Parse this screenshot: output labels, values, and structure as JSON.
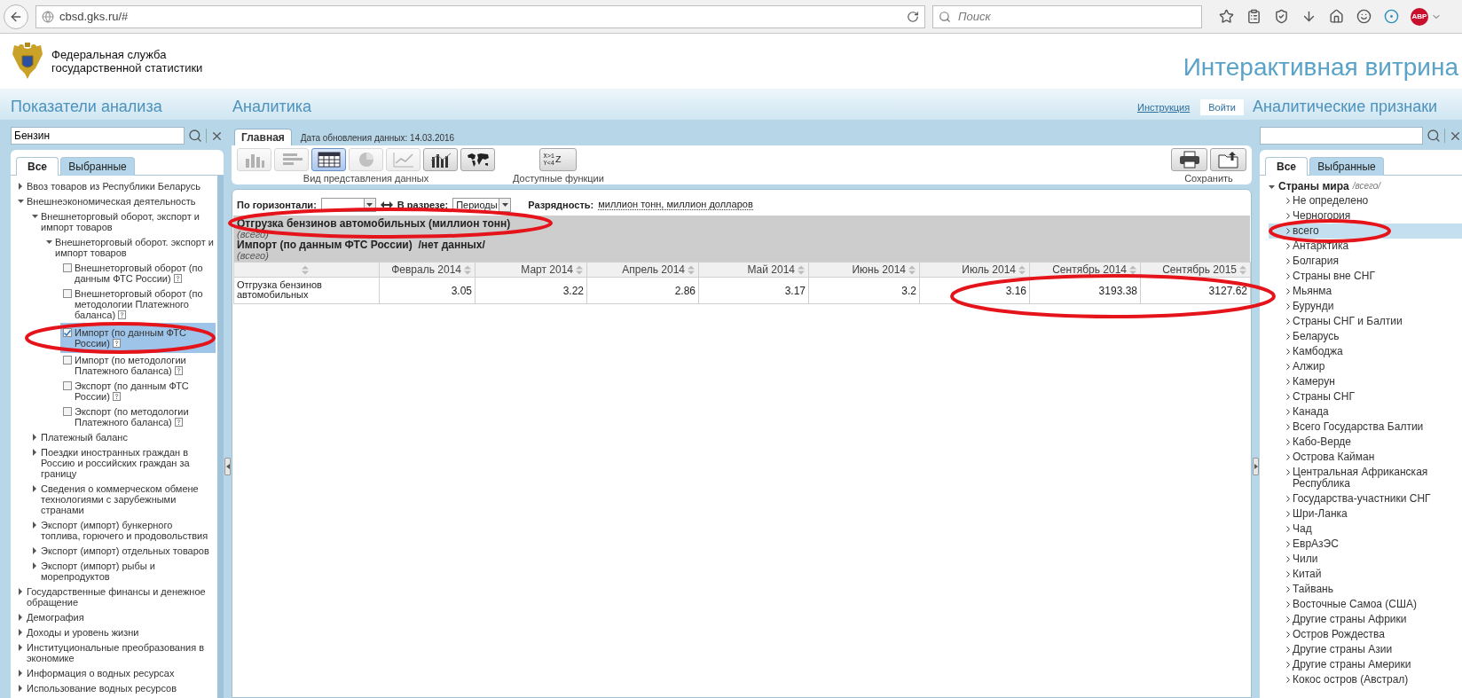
{
  "browser": {
    "url": "cbsd.gks.ru/#",
    "search_placeholder": "Поиск",
    "adblock_label": "ABP"
  },
  "header": {
    "org_lines": [
      "Федеральная служба",
      "государственной статистики"
    ],
    "title": "Интерактивная витрина"
  },
  "section_bar": {
    "left_title": "Показатели анализа",
    "center_title": "Аналитика",
    "help_link": "Инструкция",
    "login_button": "Войти",
    "right_title": "Аналитические признаки"
  },
  "left_panel": {
    "search": {
      "value": "Бензин"
    },
    "tabs": [
      {
        "label": "Все",
        "selected": true
      },
      {
        "label": "Выбранные",
        "selected": false
      }
    ],
    "tree": [
      {
        "kind": "group",
        "label": "Ввоз товаров из Республики Беларусь",
        "expanded": false
      },
      {
        "kind": "group",
        "label": "Внешнеэкономическая деятельность",
        "expanded": true,
        "children": [
          {
            "kind": "group",
            "label": "Внешнеторговый оборот, экспорт и импорт товаров",
            "expanded": true,
            "children": [
              {
                "kind": "group",
                "label": "Внешнеторговый оборот. экспорт и импорт товаров",
                "expanded": true,
                "children": [
                  {
                    "kind": "check",
                    "label": "Внешнеторговый оборот (по данным ФТС России)",
                    "checked": false,
                    "selected": false,
                    "circled": false
                  },
                  {
                    "kind": "check",
                    "label": "Внешнеторговый оборот (по методологии Платежного баланса)",
                    "checked": false,
                    "selected": false,
                    "circled": false
                  },
                  {
                    "kind": "check",
                    "label": "Импорт (по данным ФТС России)",
                    "checked": true,
                    "selected": true,
                    "circled": true
                  },
                  {
                    "kind": "check",
                    "label": "Импорт (по методологии Платежного баланса)",
                    "checked": false,
                    "selected": false,
                    "circled": false
                  },
                  {
                    "kind": "check",
                    "label": "Экспорт (по данным ФТС России)",
                    "checked": false,
                    "selected": false,
                    "circled": false
                  },
                  {
                    "kind": "check",
                    "label": "Экспорт (по методологии Платежного баланса)",
                    "checked": false,
                    "selected": false,
                    "circled": false
                  }
                ]
              }
            ]
          },
          {
            "kind": "group",
            "label": "Платежный баланс",
            "expanded": false
          },
          {
            "kind": "group",
            "label": "Поездки иностранных граждан в Россию и российских граждан за границу",
            "expanded": false
          },
          {
            "kind": "group",
            "label": "Сведения о коммерческом обмене технологиями с зарубежными странами",
            "expanded": false
          },
          {
            "kind": "group",
            "label": "Экспорт (импорт) бункерного топлива, горючего и продовольствия",
            "expanded": false
          },
          {
            "kind": "group",
            "label": "Экспорт (импорт) отдельных товаров",
            "expanded": false
          },
          {
            "kind": "group",
            "label": "Экспорт (импорт) рыбы и морепродуктов",
            "expanded": false
          }
        ]
      },
      {
        "kind": "group",
        "label": "Государственные финансы и денежное обращение",
        "expanded": false
      },
      {
        "kind": "group",
        "label": "Демография",
        "expanded": false
      },
      {
        "kind": "group",
        "label": "Доходы и уровень жизни",
        "expanded": false
      },
      {
        "kind": "group",
        "label": "Институциональные преобразования в экономике",
        "expanded": false
      },
      {
        "kind": "group",
        "label": "Информация о водных ресурсах",
        "expanded": false
      },
      {
        "kind": "group",
        "label": "Использование водных ресурсов",
        "expanded": false
      }
    ]
  },
  "center": {
    "tabs": [
      {
        "label": "Главная",
        "selected": true
      }
    ],
    "update_date": "Дата обновления данных: 14.03.2016",
    "view_buttons": [
      {
        "kind": "bar",
        "selected": false,
        "disabled": true
      },
      {
        "kind": "hbar",
        "selected": false,
        "disabled": true
      },
      {
        "kind": "table",
        "selected": true,
        "disabled": false
      },
      {
        "kind": "pie",
        "selected": false,
        "disabled": true
      },
      {
        "kind": "line",
        "selected": false,
        "disabled": true
      },
      {
        "kind": "combo",
        "selected": false,
        "disabled": false
      },
      {
        "kind": "map",
        "selected": false,
        "disabled": false
      }
    ],
    "view_label": "Вид представления данных",
    "functions_button": {
      "lines": [
        "X>1",
        "Y<4"
      ],
      "suffix": "Z"
    },
    "functions_label": "Доступные функции",
    "save_buttons": [
      {
        "kind": "print"
      },
      {
        "kind": "export"
      }
    ],
    "save_label": "Сохранить",
    "controls": {
      "horizontal_label": "По горизонтали:",
      "slice_label": "В разрезе:",
      "slice_value": "Периоды",
      "scale_label": "Разрядность:",
      "scale_value": "миллион тонн, миллион долларов"
    },
    "header_block": [
      {
        "kind": "title",
        "text": "Отгрузка бензинов автомобильных (миллион тонн)",
        "circled": true
      },
      {
        "kind": "note",
        "text": "(всего)",
        "circled": false
      },
      {
        "kind": "title",
        "text": "Импорт (по данным ФТС России)  /нет данных/",
        "circled": false
      },
      {
        "kind": "note",
        "text": "(всего)",
        "circled": false
      }
    ],
    "table": {
      "columns": [
        "Февраль 2014",
        "Март 2014",
        "Апрель 2014",
        "Май 2014",
        "Июнь 2014",
        "Июль 2014",
        "Сентябрь 2014",
        "Сентябрь 2015"
      ],
      "rows": [
        {
          "label": "Отгрузка бензинов автомобильных",
          "cells": [
            {
              "value": "3.05",
              "circled": false
            },
            {
              "value": "3.22",
              "circled": false
            },
            {
              "value": "2.86",
              "circled": false
            },
            {
              "value": "3.17",
              "circled": false
            },
            {
              "value": "3.2",
              "circled": false
            },
            {
              "value": "3.16",
              "circled": true
            },
            {
              "value": "3193.38",
              "circled": true
            },
            {
              "value": "3127.62",
              "circled": true
            }
          ]
        }
      ]
    }
  },
  "right_panel": {
    "tabs": [
      {
        "label": "Все",
        "selected": true
      },
      {
        "label": "Выбранные",
        "selected": false
      }
    ],
    "tree": {
      "label": "Страны мира",
      "note": "/всего/",
      "expanded": true,
      "children": [
        {
          "label": "Не определено",
          "selected": false,
          "circled": false
        },
        {
          "label": "Черногория",
          "selected": false,
          "circled": false
        },
        {
          "label": "всего",
          "selected": true,
          "circled": true
        },
        {
          "label": "Антарктика",
          "selected": false,
          "circled": false
        },
        {
          "label": "Болгария",
          "selected": false,
          "circled": false
        },
        {
          "label": "Страны вне СНГ",
          "selected": false,
          "circled": false
        },
        {
          "label": "Мьянма",
          "selected": false,
          "circled": false
        },
        {
          "label": "Бурунди",
          "selected": false,
          "circled": false
        },
        {
          "label": "Страны СНГ и Балтии",
          "selected": false,
          "circled": false
        },
        {
          "label": "Беларусь",
          "selected": false,
          "circled": false
        },
        {
          "label": "Камбоджа",
          "selected": false,
          "circled": false
        },
        {
          "label": "Алжир",
          "selected": false,
          "circled": false
        },
        {
          "label": "Камерун",
          "selected": false,
          "circled": false
        },
        {
          "label": "Страны СНГ",
          "selected": false,
          "circled": false
        },
        {
          "label": "Канада",
          "selected": false,
          "circled": false
        },
        {
          "label": "Всего Государства Балтии",
          "selected": false,
          "circled": false
        },
        {
          "label": "Кабо-Верде",
          "selected": false,
          "circled": false
        },
        {
          "label": "Острова Кайман",
          "selected": false,
          "circled": false
        },
        {
          "label": "Центральная Африканская Республика",
          "selected": false,
          "circled": false
        },
        {
          "label": "Государства-участники СНГ",
          "selected": false,
          "circled": false
        },
        {
          "label": "Шри-Ланка",
          "selected": false,
          "circled": false
        },
        {
          "label": "Чад",
          "selected": false,
          "circled": false
        },
        {
          "label": "ЕврАзЭС",
          "selected": false,
          "circled": false
        },
        {
          "label": "Чили",
          "selected": false,
          "circled": false
        },
        {
          "label": "Китай",
          "selected": false,
          "circled": false
        },
        {
          "label": "Тайвань",
          "selected": false,
          "circled": false
        },
        {
          "label": "Восточные Самоа (США)",
          "selected": false,
          "circled": false
        },
        {
          "label": "Другие страны Африки",
          "selected": false,
          "circled": false
        },
        {
          "label": "Остров Рождества",
          "selected": false,
          "circled": false
        },
        {
          "label": "Другие страны Азии",
          "selected": false,
          "circled": false
        },
        {
          "label": "Другие страны Америки",
          "selected": false,
          "circled": false
        },
        {
          "label": "Кокос остров (Австрал)",
          "selected": false,
          "circled": false
        }
      ]
    }
  }
}
